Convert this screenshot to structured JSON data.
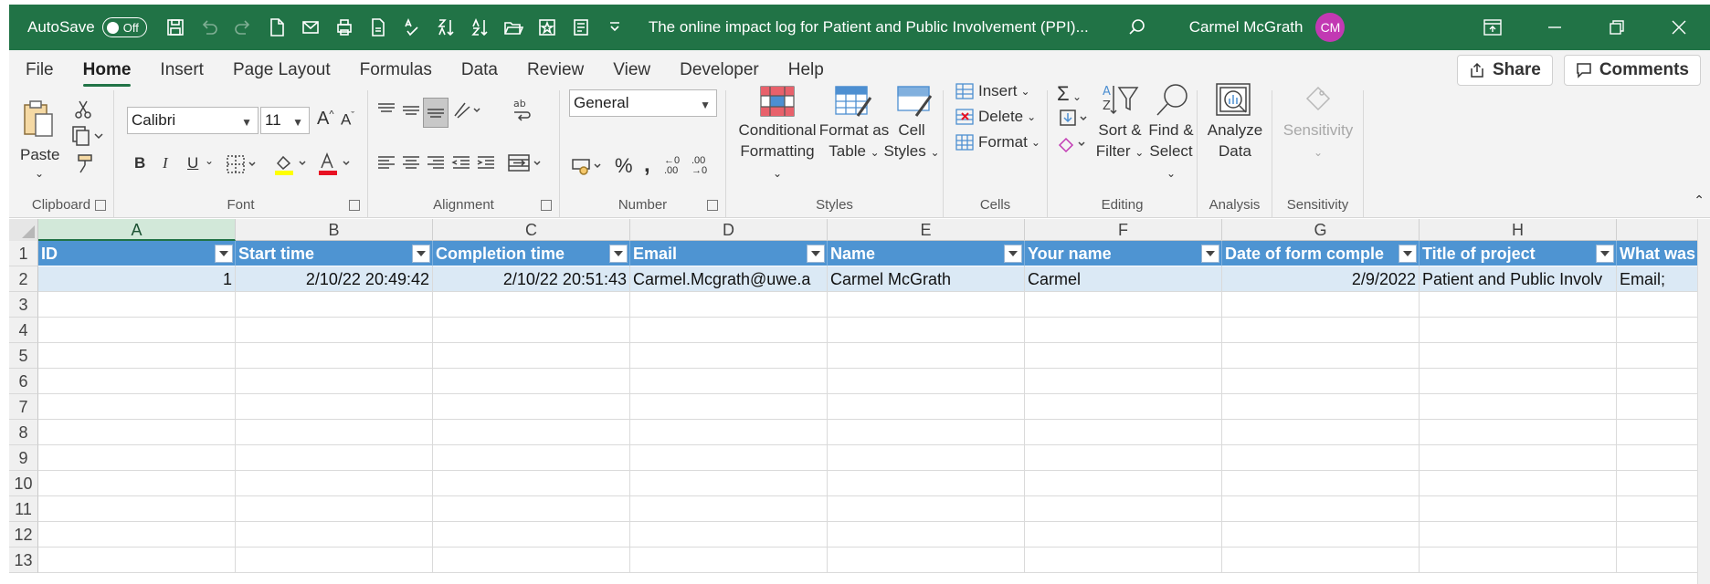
{
  "titlebar": {
    "autosave_label": "AutoSave",
    "autosave_state": "Off",
    "doc_title": "The online impact log for Patient and Public Involvement (PPI)...",
    "user_name": "Carmel McGrath",
    "user_initials": "CM",
    "accent": "#217346",
    "avatar_color": "#c239b3"
  },
  "menu": {
    "tabs": [
      "File",
      "Home",
      "Insert",
      "Page Layout",
      "Formulas",
      "Data",
      "Review",
      "View",
      "Developer",
      "Help"
    ],
    "active": "Home",
    "share_label": "Share",
    "comments_label": "Comments"
  },
  "ribbon": {
    "clipboard": {
      "label": "Clipboard",
      "paste": "Paste"
    },
    "font": {
      "label": "Font",
      "name": "Calibri",
      "size": "11",
      "bold": "B",
      "italic": "I",
      "underline": "U"
    },
    "alignment": {
      "label": "Alignment"
    },
    "number": {
      "label": "Number",
      "format": "General"
    },
    "styles": {
      "label": "Styles",
      "conditional_1": "Conditional",
      "conditional_2": "Formatting",
      "format_table_1": "Format as",
      "format_table_2": "Table",
      "cell_styles_1": "Cell",
      "cell_styles_2": "Styles"
    },
    "cells": {
      "label": "Cells",
      "insert": "Insert",
      "delete": "Delete",
      "format": "Format"
    },
    "editing": {
      "label": "Editing",
      "sort_1": "Sort &",
      "sort_2": "Filter",
      "find_1": "Find &",
      "find_2": "Select"
    },
    "analysis": {
      "label": "Analysis",
      "analyze_1": "Analyze",
      "analyze_2": "Data"
    },
    "sensitivity": {
      "label": "Sensitivity",
      "button": "Sensitivity"
    }
  },
  "grid": {
    "selected_column": "A",
    "columns": [
      "A",
      "B",
      "C",
      "D",
      "E",
      "F",
      "G",
      "H"
    ],
    "row_numbers": [
      "1",
      "2",
      "3",
      "4",
      "5",
      "6",
      "7",
      "8",
      "9",
      "10",
      "11",
      "12",
      "13"
    ],
    "headers": [
      "ID",
      "Start time",
      "Completion time",
      "Email",
      "Name",
      "Your name",
      "Date of form comple",
      "Title of project",
      "What was"
    ],
    "row2": [
      "1",
      "2/10/22 20:49:42",
      "2/10/22 20:51:43",
      "Carmel.Mcgrath@uwe.a",
      "Carmel McGrath",
      "Carmel",
      "2/9/2022",
      "Patient and Public Involv",
      "Email;"
    ],
    "header_color": "#4e94d2",
    "row_color": "#dbe9f5"
  }
}
